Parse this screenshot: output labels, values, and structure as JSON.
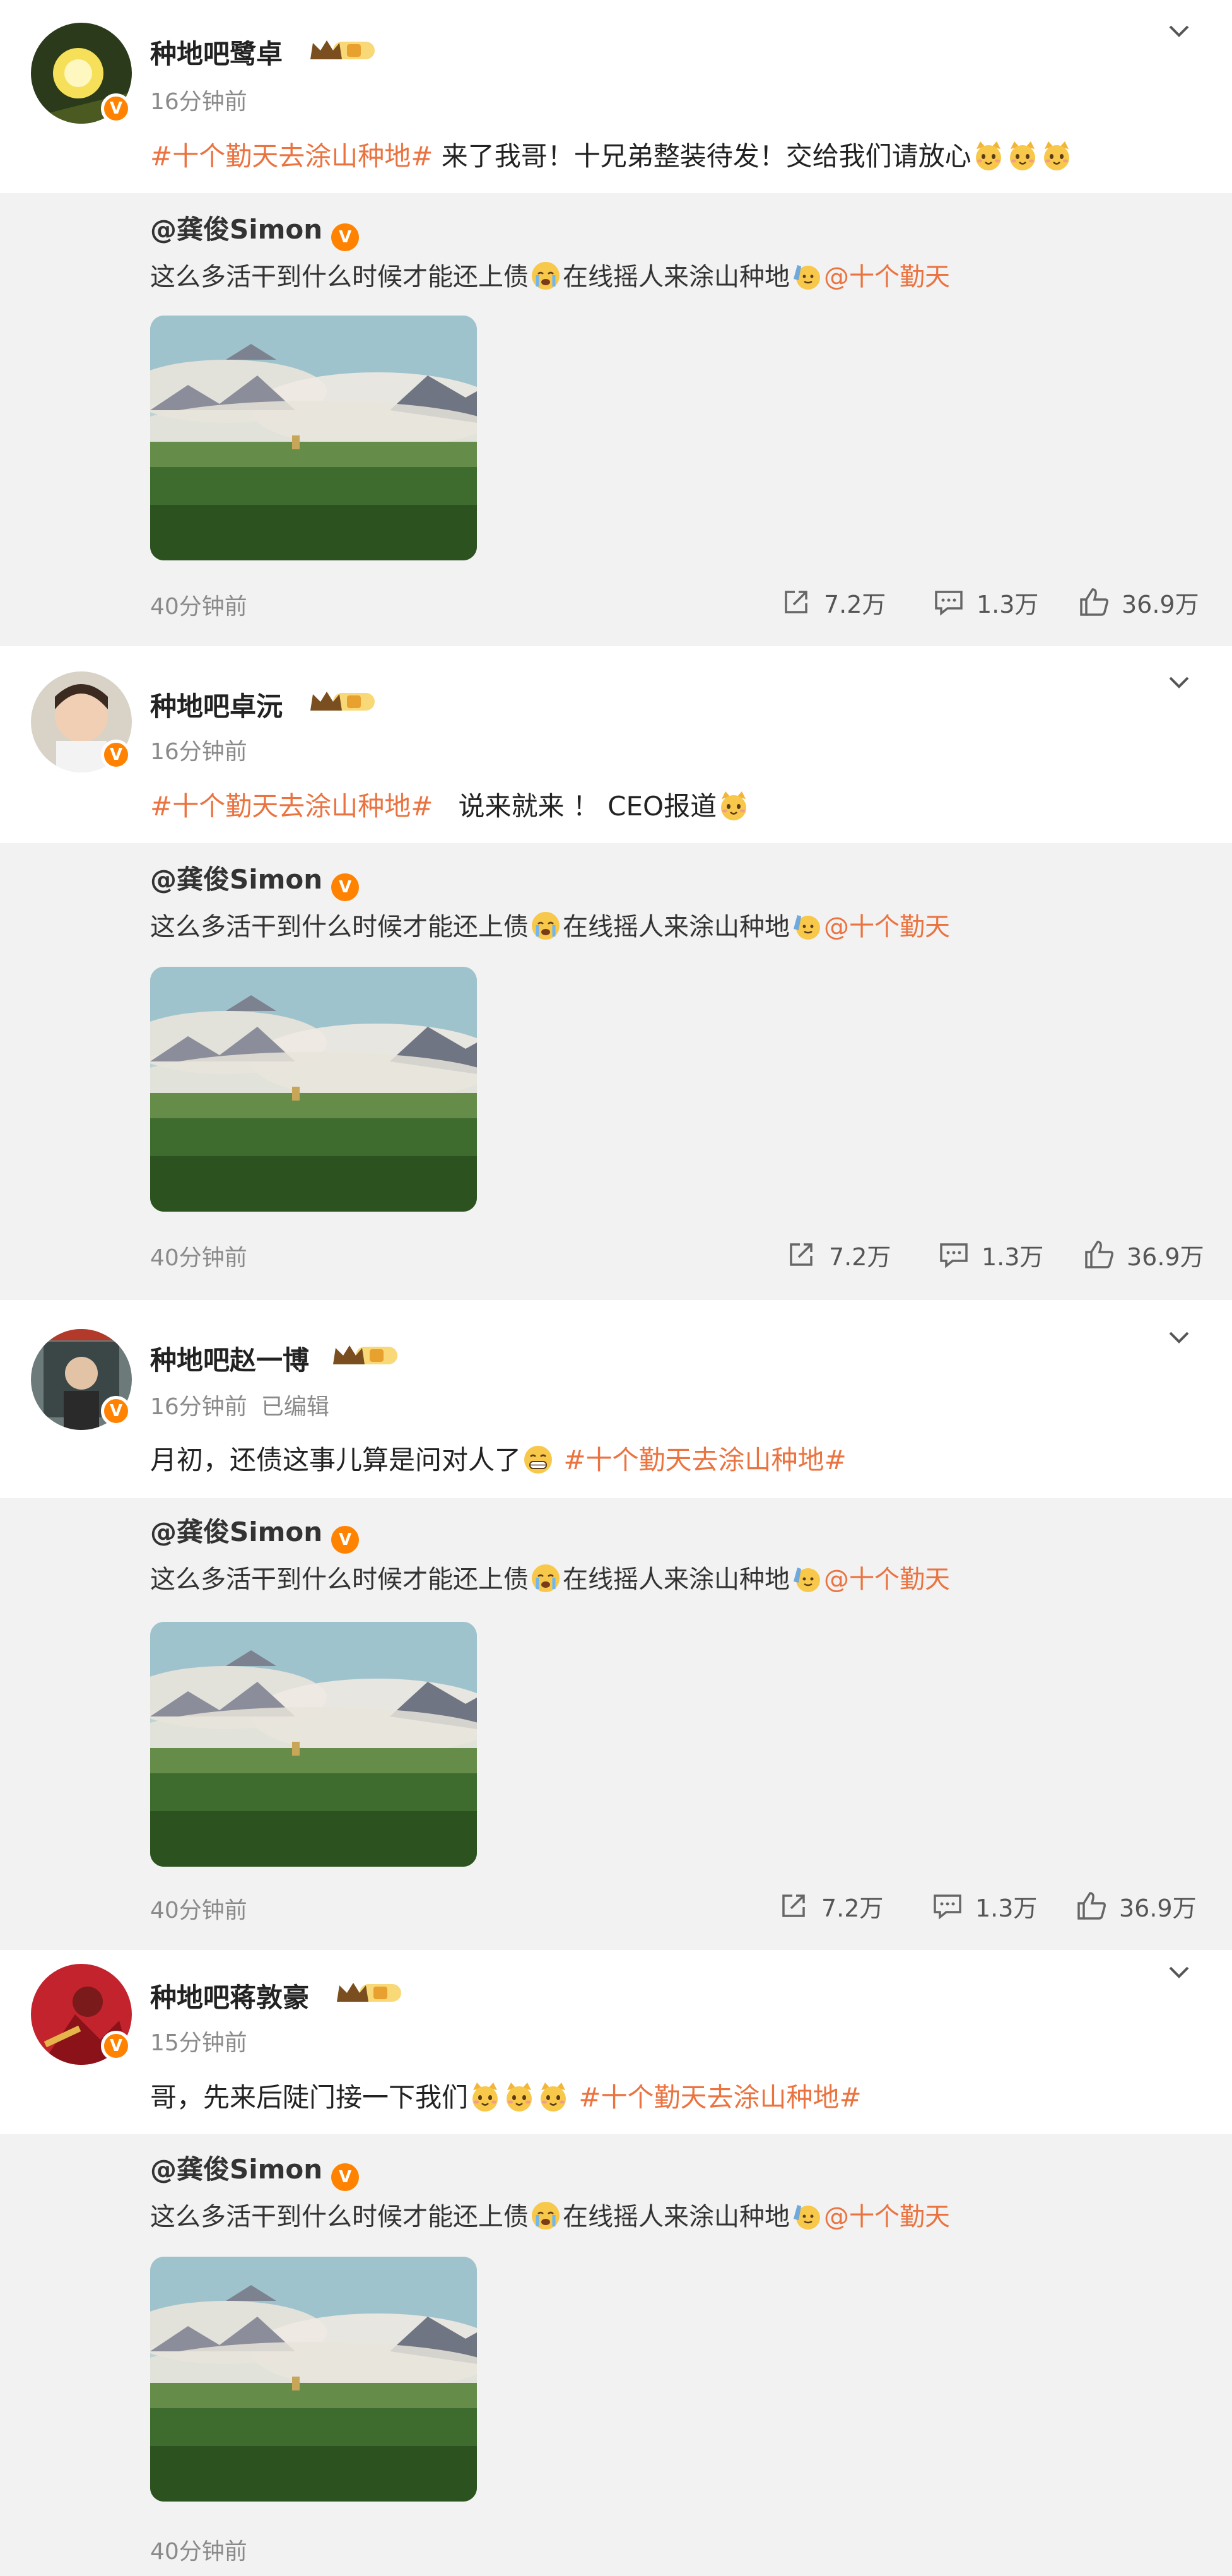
{
  "colors": {
    "accent": "#eb7340",
    "badge": "#ff8200",
    "repost_bg": "#f2f2f2"
  },
  "posts": [
    {
      "username": "种地吧鹭卓",
      "level": "1",
      "time": "16分钟前",
      "edited": "",
      "tag": "#十个勤天去涂山种地#",
      "text": " 来了我哥！十兄弟整装待发！交给我们请放心",
      "emojis": [
        "cat-emoji",
        "cat-emoji",
        "cat-emoji"
      ],
      "avatar": "sunset-avatar",
      "repost": {
        "user": "@龚俊Simon",
        "text_a": "这么多活干到什么时候才能还上债",
        "text_b": "在线摇人来涂山种地",
        "mention": "@十个勤天",
        "time": "40分钟前",
        "shares": "7.2万",
        "comments": "1.3万",
        "likes": "36.9万"
      }
    },
    {
      "username": "种地吧卓沅",
      "level": "1",
      "time": "16分钟前",
      "edited": "",
      "tag": "#十个勤天去涂山种地#",
      "text": "   说来就来 ！ CEO报道",
      "emojis": [
        "cat-emoji"
      ],
      "avatar": "person-avatar",
      "repost": {
        "user": "@龚俊Simon",
        "text_a": "这么多活干到什么时候才能还上债",
        "text_b": "在线摇人来涂山种地",
        "mention": "@十个勤天",
        "time": "40分钟前",
        "shares": "7.2万",
        "comments": "1.3万",
        "likes": "36.9万"
      }
    },
    {
      "username": "种地吧赵一博",
      "level": "1",
      "time": "16分钟前",
      "edited": "已编辑",
      "text_before": "月初，还债这事儿算是问对人了",
      "tag": " #十个勤天去涂山种地#",
      "emojis": [
        "grin-emoji"
      ],
      "avatar": "window-avatar",
      "repost": {
        "user": "@龚俊Simon",
        "text_a": "这么多活干到什么时候才能还上债",
        "text_b": "在线摇人来涂山种地",
        "mention": "@十个勤天",
        "time": "40分钟前",
        "shares": "7.2万",
        "comments": "1.3万",
        "likes": "36.9万"
      }
    },
    {
      "username": "种地吧蒋敦豪",
      "level": "1",
      "time": "15分钟前",
      "edited": "",
      "text_before": "哥，先来后陡门接一下我们",
      "tag": " #十个勤天去涂山种地#",
      "emojis": [
        "cat-emoji",
        "cat-emoji",
        "cat-emoji"
      ],
      "avatar": "red-avatar",
      "repost": {
        "user": "@龚俊Simon",
        "text_a": "这么多活干到什么时候才能还上债",
        "text_b": "在线摇人来涂山种地",
        "mention": "@十个勤天",
        "time": "40分钟前"
      }
    }
  ]
}
